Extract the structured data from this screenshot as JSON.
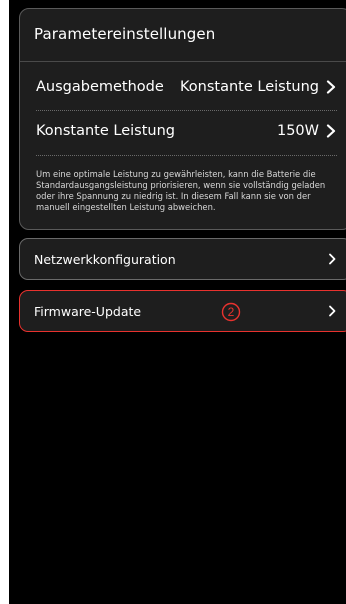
{
  "params_card": {
    "title": "Parametereinstellungen",
    "output_method_label": "Ausgabemethode",
    "output_method_value": "Konstante Leistung",
    "constant_power_label": "Konstante Leistung",
    "constant_power_value": "150W",
    "info_text": "Um eine optimale Leistung zu gewährleisten, kann die Batterie die Standardausgangsleistung priorisieren, wenn sie vollständig geladen oder ihre Spannung zu niedrig ist. In diesem Fall kann sie von der manuell eingestellten Leistung abweichen."
  },
  "network": {
    "label": "Netzwerkkonfiguration"
  },
  "firmware": {
    "label": "Firmware-Update",
    "step_marker": "②"
  },
  "icons": {
    "chevron": "chevron-right-icon"
  },
  "colors": {
    "background": "#000000",
    "card": "#1e1e1e",
    "highlight": "#e8322e",
    "text": "#ffffff"
  }
}
